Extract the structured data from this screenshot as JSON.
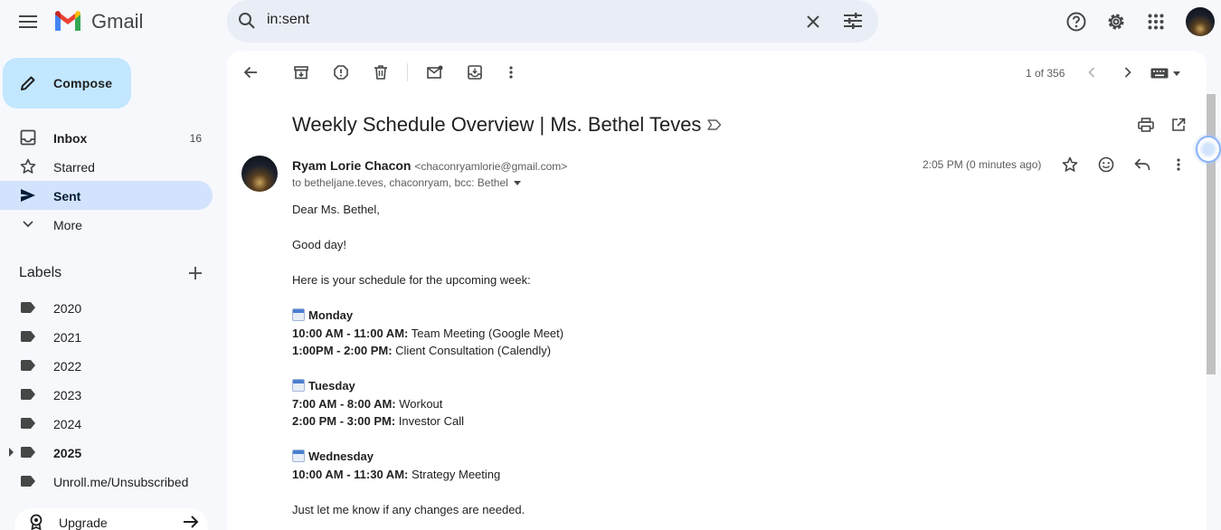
{
  "app": {
    "name": "Gmail",
    "accent": "#0b57d0",
    "nav_active_bg": "#d3e3fd",
    "compose_bg": "#c2e7ff"
  },
  "header": {
    "menu_icon": "menu-icon",
    "search": {
      "value": "in:sent",
      "clear_icon": "close-icon",
      "filter_icon": "tune-icon"
    },
    "help_icon": "help-icon",
    "settings_icon": "gear-icon",
    "apps_icon": "apps-grid-icon"
  },
  "compose": {
    "label": "Compose"
  },
  "nav": [
    {
      "label": "Inbox",
      "count": "16",
      "icon": "inbox-icon",
      "bold": true
    },
    {
      "label": "Starred",
      "count": "",
      "icon": "star-icon"
    },
    {
      "label": "Sent",
      "count": "",
      "icon": "send-icon",
      "active": true
    },
    {
      "label": "More",
      "count": "",
      "icon": "chevron-down-icon"
    }
  ],
  "labels": {
    "title": "Labels",
    "items": [
      "2020",
      "2021",
      "2022",
      "2023",
      "2024",
      "2025",
      "Unroll.me/Unsubscribed"
    ]
  },
  "upgrade": {
    "label": "Upgrade"
  },
  "toolbar": {
    "pagination": "1 of 356"
  },
  "email": {
    "subject": "Weekly Schedule Overview | Ms. Bethel Teves",
    "sender_name": "Ryam Lorie Chacon",
    "sender_email": "<chaconryamlorie@gmail.com>",
    "to_line": "to betheljane.teves, chaconryam, bcc: Bethel",
    "time": "2:05 PM (0 minutes ago)",
    "greeting": "Dear Ms. Bethel,",
    "opener": "Good day!",
    "intro": "Here is your schedule for the upcoming week:",
    "days": [
      {
        "day": "Monday",
        "events": [
          {
            "time": "10:00 AM - 11:00 AM:",
            "desc": " Team Meeting (Google Meet)"
          },
          {
            "time": "1:00PM - 2:00 PM:",
            "desc": " Client Consultation (Calendly)"
          }
        ]
      },
      {
        "day": "Tuesday",
        "events": [
          {
            "time": "7:00 AM - 8:00 AM:",
            "desc": " Workout"
          },
          {
            "time": "2:00 PM - 3:00 PM:",
            "desc": " Investor Call"
          }
        ]
      },
      {
        "day": "Wednesday",
        "events": [
          {
            "time": "10:00 AM - 11:30 AM:",
            "desc": " Strategy Meeting"
          }
        ]
      }
    ],
    "closing": "Just let me know if any changes are needed."
  }
}
